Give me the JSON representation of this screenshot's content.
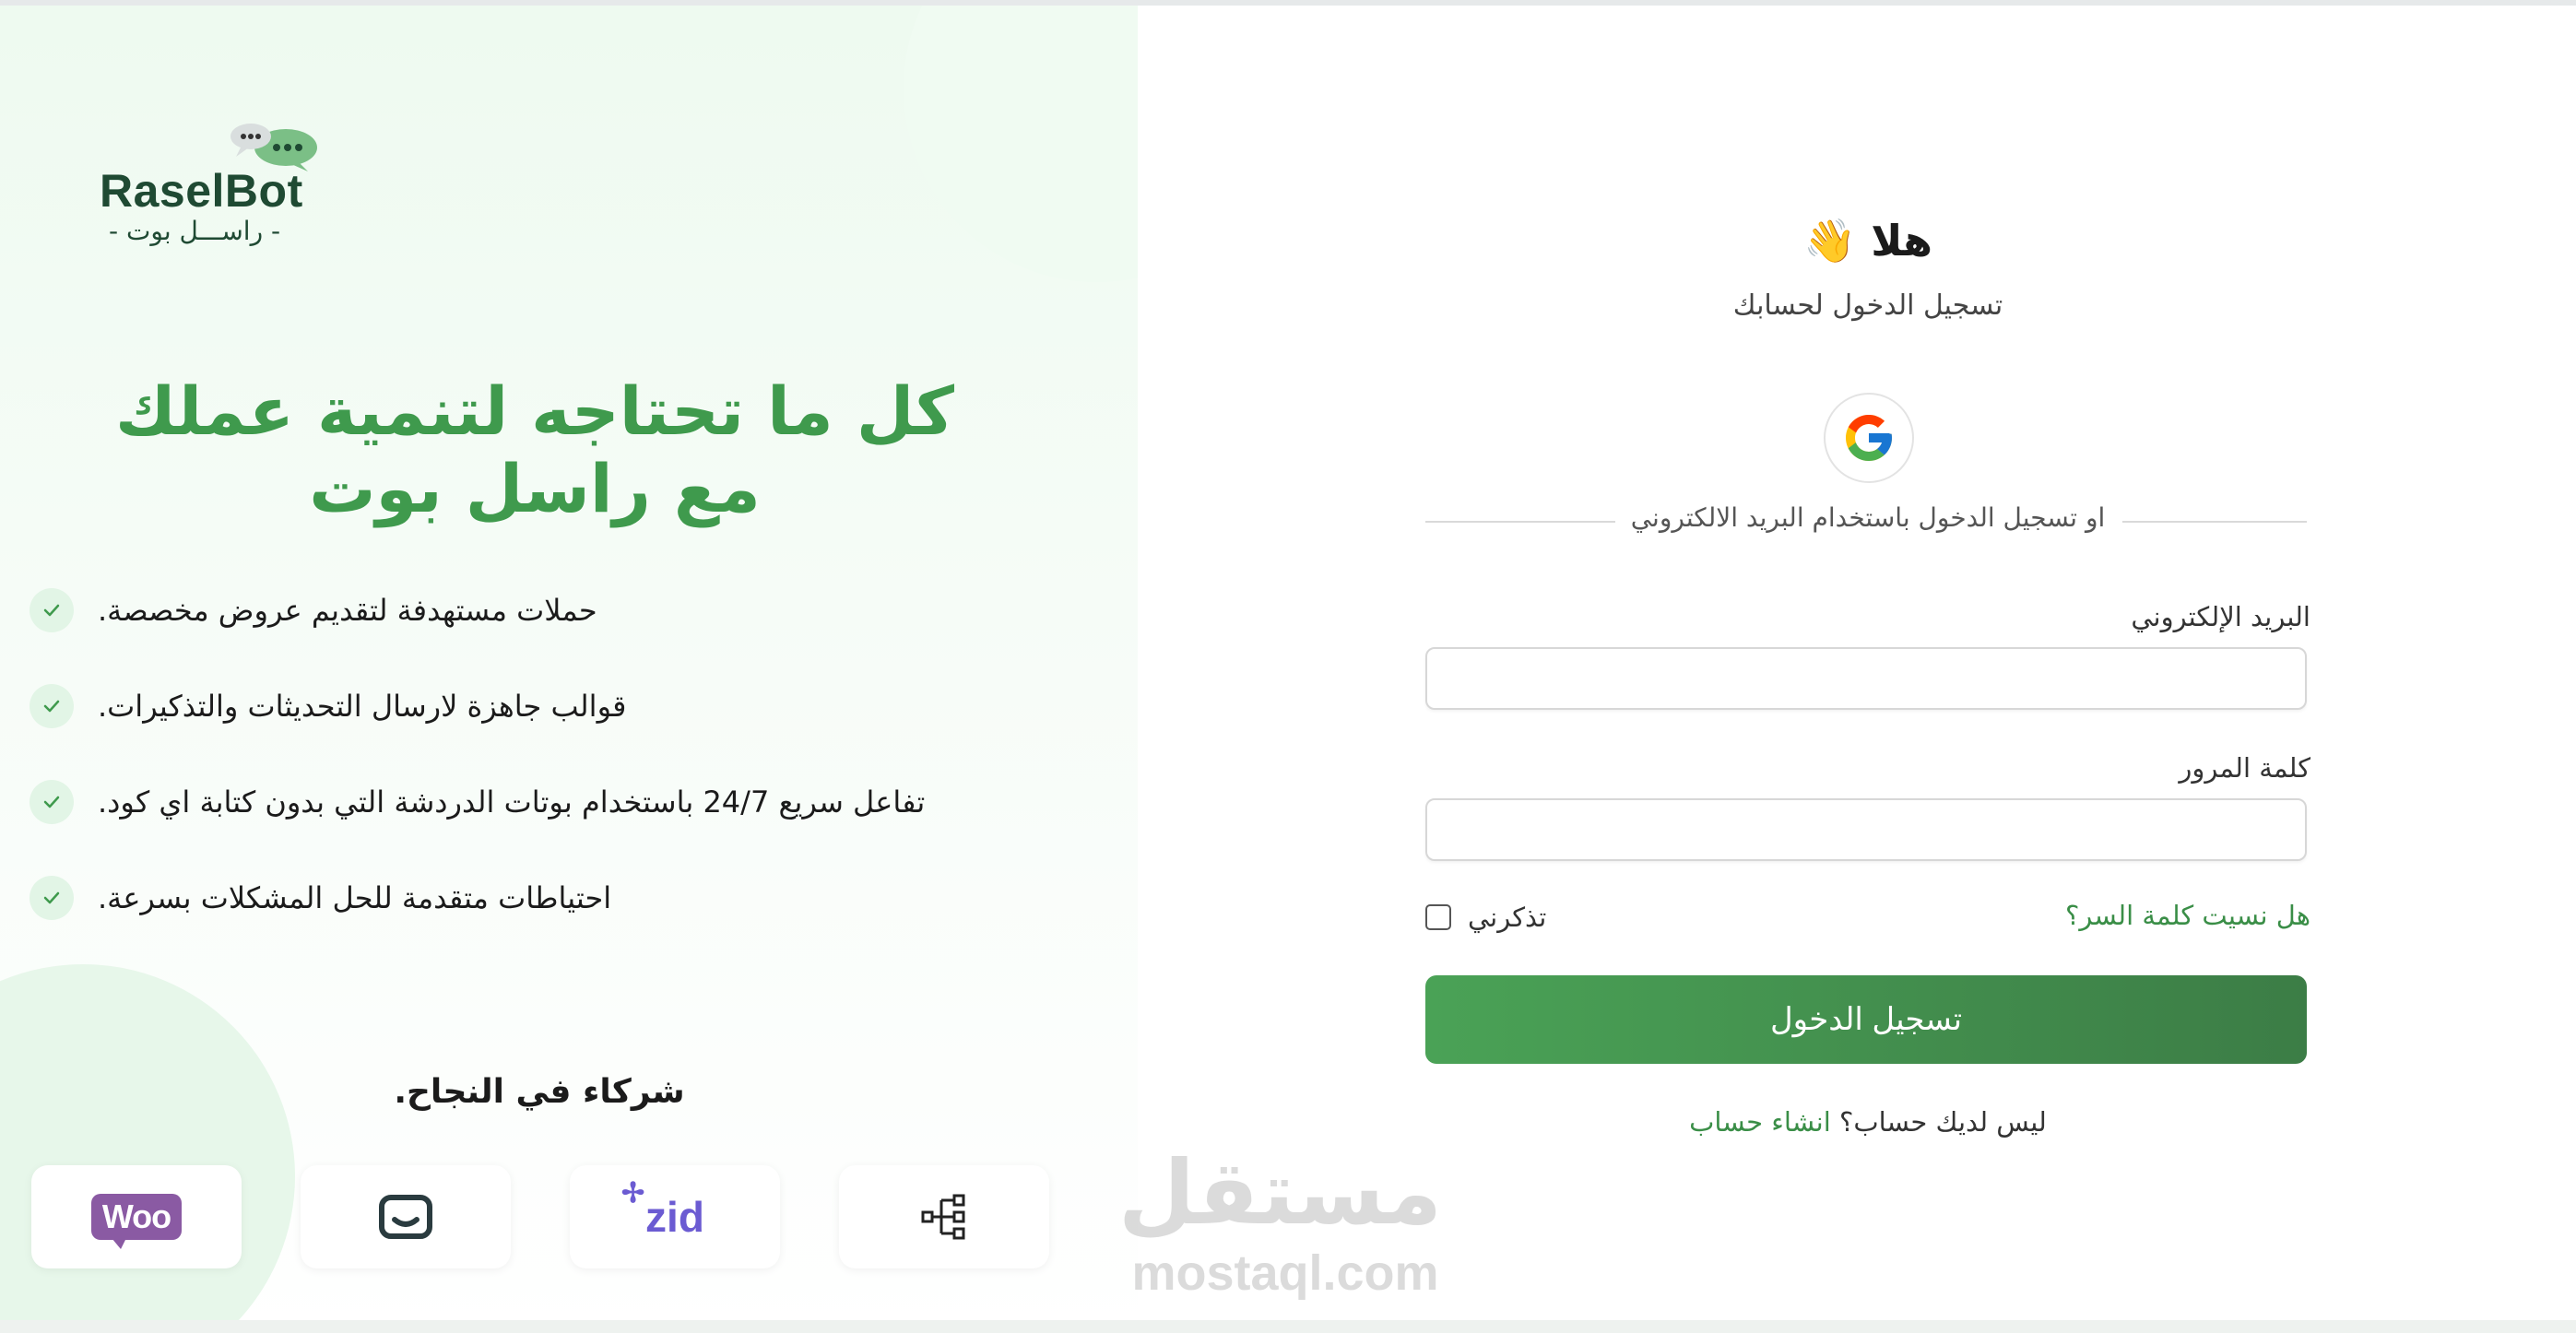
{
  "brand": {
    "name": "RaselBot",
    "arabic_name": "- راســـل بوت -",
    "accent_color": "#3f9a4d"
  },
  "hero": {
    "title": "كل ما تحتاجه لتنمية عملك مع راسل بوت"
  },
  "features": [
    {
      "text": "حملات مستهدفة لتقديم عروض مخصصة.",
      "icon": "check-icon"
    },
    {
      "text": "قوالب جاهزة لارسال التحديثات والتذكيرات.",
      "icon": "check-icon"
    },
    {
      "text": "تفاعل سريع 24/7 باستخدام بوتات الدردشة التي بدون كتابة اي كود.",
      "icon": "check-icon"
    },
    {
      "text": "احتياطات متقدمة للحل المشكلات بسرعة.",
      "icon": "check-icon"
    }
  ],
  "partners": {
    "title": "شركاء في النجاح.",
    "items": [
      {
        "name": "Woo",
        "icon": "woocommerce-icon"
      },
      {
        "name": "salla",
        "icon": "salla-icon"
      },
      {
        "name": "zid",
        "icon": "zid-icon"
      },
      {
        "name": "nodes",
        "icon": "network-nodes-icon"
      }
    ]
  },
  "login": {
    "greeting": "هلا 👋",
    "subtitle": "تسجيل الدخول لحسابك",
    "google_icon": "google-icon",
    "divider_text": "او تسجيل الدخول باستخدام البريد الالكتروني",
    "email_label": "البريد الإلكتروني",
    "email_value": "",
    "password_label": "كلمة المرور",
    "password_value": "",
    "forgot_password": "هل نسيت كلمة السر؟",
    "remember_me": "تذكرني",
    "submit_label": "تسجيل الدخول",
    "no_account_text": "ليس لديك حساب؟",
    "signup_link": "انشاء حساب"
  },
  "watermark": {
    "arabic": "مستقل",
    "latin": "mostaql.com"
  }
}
